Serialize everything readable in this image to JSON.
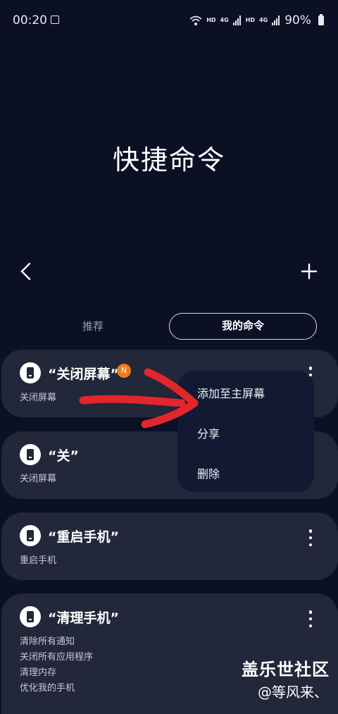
{
  "status": {
    "time": "00:20",
    "hd1": "HD",
    "net1": "4G",
    "hd2": "HD",
    "net2": "4G",
    "battery": "90%"
  },
  "page": {
    "title": "快捷命令"
  },
  "tabs": {
    "recommended": "推荐",
    "mine": "我的命令"
  },
  "commands": [
    {
      "title": "“关闭屏幕”",
      "badge": "N",
      "steps": [
        "关闭屏幕"
      ]
    },
    {
      "title": "“关”",
      "steps": [
        "关闭屏幕"
      ]
    },
    {
      "title": "“重启手机”",
      "steps": [
        "重启手机"
      ]
    },
    {
      "title": "“清理手机”",
      "steps": [
        "清除所有通知",
        "关闭所有应用程序",
        "清理内存",
        "优化我的手机"
      ]
    }
  ],
  "context_menu": {
    "add_home": "添加至主屏幕",
    "share": "分享",
    "delete": "删除"
  },
  "watermark": {
    "site": "盖乐世社区",
    "author": "@等风来、"
  },
  "colors": {
    "background": "#0b1024",
    "card": "#22273a",
    "popup": "#121a33",
    "badge": "#f07a1a",
    "annotation_arrow": "#e2262c"
  }
}
